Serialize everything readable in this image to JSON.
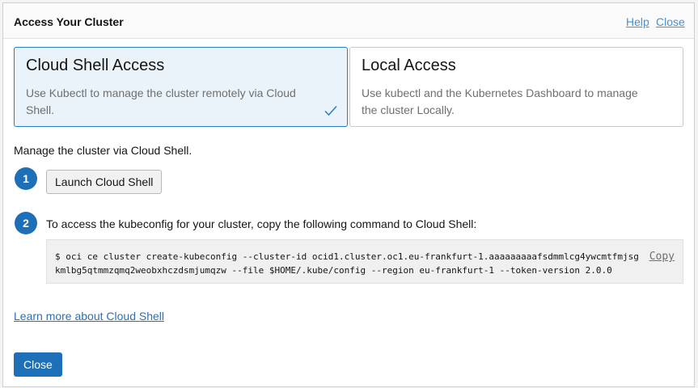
{
  "dialog": {
    "title": "Access Your Cluster",
    "help_label": "Help",
    "close_label": "Close"
  },
  "options": [
    {
      "title": "Cloud Shell Access",
      "description": "Use Kubectl to manage the cluster remotely via Cloud Shell.",
      "selected": true
    },
    {
      "title": "Local Access",
      "description": "Use kubectl and the Kubernetes Dashboard to manage the cluster Locally.",
      "selected": false
    }
  ],
  "intro": "Manage the cluster via Cloud Shell.",
  "steps": [
    {
      "number": "1",
      "button_label": "Launch Cloud Shell"
    },
    {
      "number": "2",
      "text": "To access the kubeconfig for your cluster, copy the following command to Cloud Shell:",
      "command_line1": "$ oci ce cluster create-kubeconfig --cluster-id ocid1.cluster.oc1.eu-frankfurt-1.aaaaaaaaafsdmmlcg4ywcmtfmjsg",
      "command_line2": "kmlbg5qtmmzqmq2weobxhczdsmjumqzw --file $HOME/.kube/config --region eu-frankfurt-1 --token-version 2.0.0",
      "copy_label": "Copy"
    }
  ],
  "learn_more": "Learn more about Cloud Shell",
  "footer": {
    "close_label": "Close"
  },
  "colors": {
    "accent": "#1d6fb8",
    "selected_bg": "#eaf3fa",
    "link": "#2d6fb3"
  },
  "icons": {
    "check": "checkmark-icon"
  }
}
